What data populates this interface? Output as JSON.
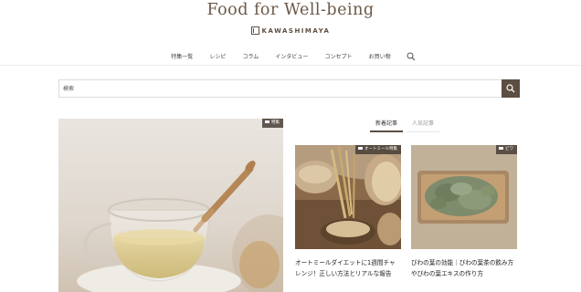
{
  "header": {
    "title": "Food for Well-being",
    "brand": "KAWASHIMAYA"
  },
  "nav": {
    "items": [
      "特集一覧",
      "レシピ",
      "コラム",
      "インタビュー",
      "コンセプト",
      "お買い物"
    ]
  },
  "search": {
    "placeholder": "検索",
    "value": ""
  },
  "hero": {
    "tag": "特集"
  },
  "tabs": {
    "new": "新着記事",
    "popular": "人気記事"
  },
  "cards": [
    {
      "tag": "オートミール特集",
      "title": "オートミールダイエットに1週間チャレンジ！正しい方法とリアルな報告"
    },
    {
      "tag": "ビワ",
      "title": "びわの葉の効能｜びわの葉茶の飲み方やびわの葉エキスの作り方"
    }
  ],
  "colors": {
    "accent": "#5d4e42",
    "title": "#6b5847"
  }
}
